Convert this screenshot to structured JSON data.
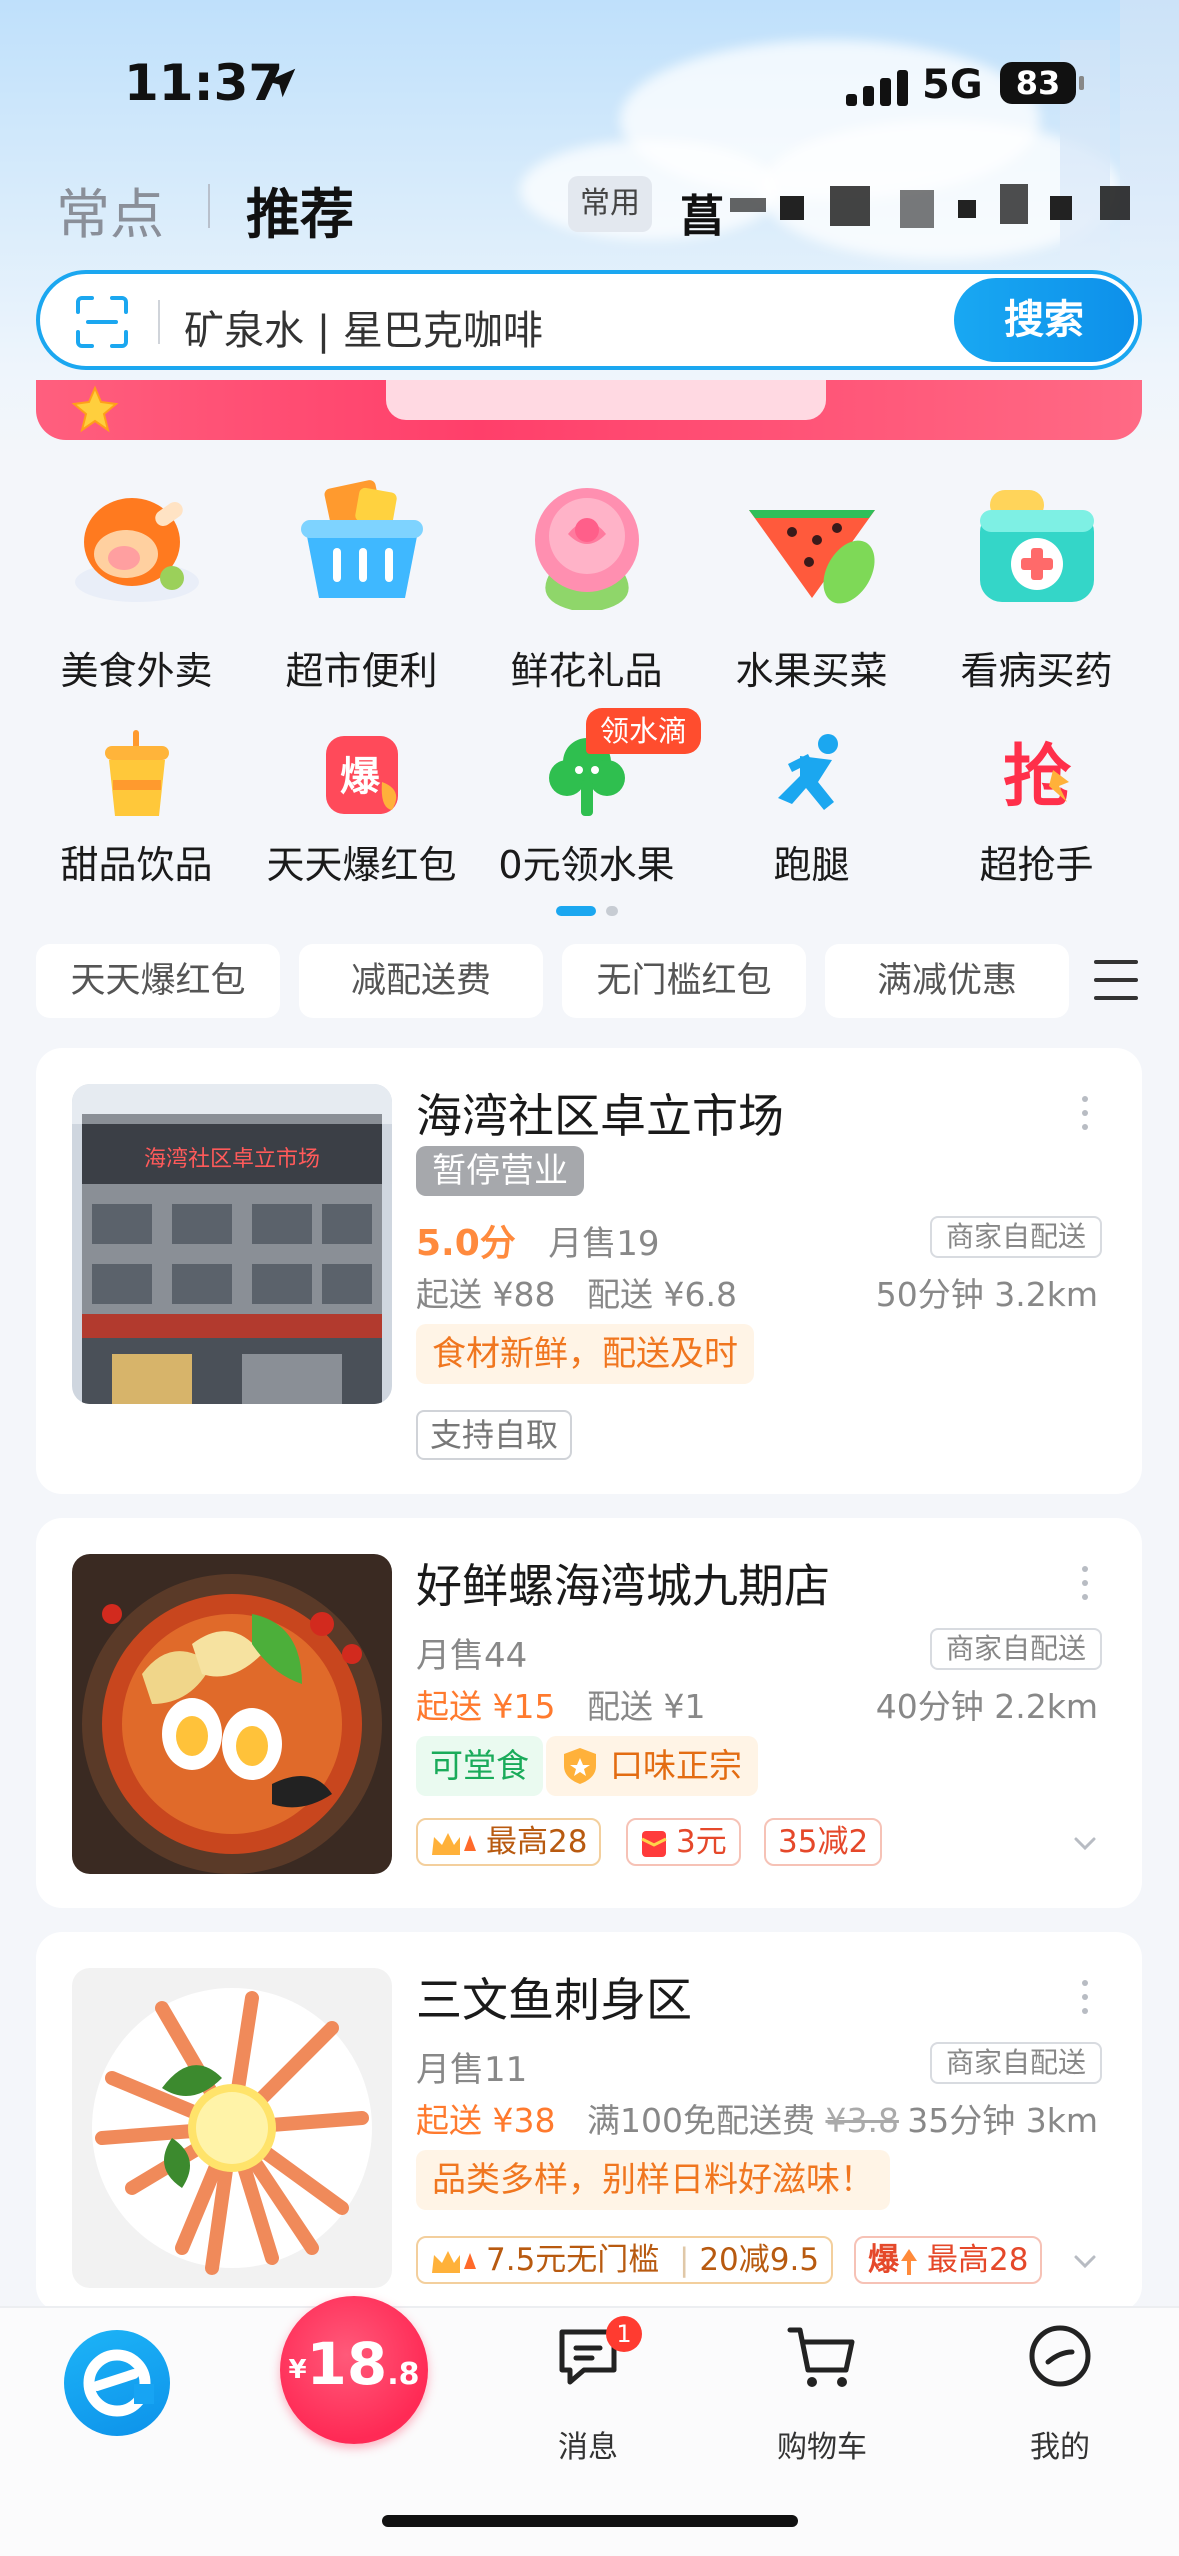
{
  "status_bar": {
    "time": "11:37",
    "network": "5G",
    "battery": "83"
  },
  "header": {
    "tabs": [
      "常点",
      "推荐"
    ],
    "address_chip": "常用",
    "address_text": "菖"
  },
  "search": {
    "placeholder": "矿泉水 | 星巴克咖啡",
    "button": "搜索"
  },
  "categories_row1": [
    {
      "label": "美食外卖",
      "icon": "food-icon"
    },
    {
      "label": "超市便利",
      "icon": "basket-icon"
    },
    {
      "label": "鲜花礼品",
      "icon": "rose-icon"
    },
    {
      "label": "水果买菜",
      "icon": "watermelon-icon"
    },
    {
      "label": "看病买药",
      "icon": "medicine-icon"
    }
  ],
  "categories_row2": [
    {
      "label": "甜品饮品",
      "icon": "drink-icon"
    },
    {
      "label": "天天爆红包",
      "icon": "red-packet-icon",
      "icon_text": "爆"
    },
    {
      "label": "0元领水果",
      "icon": "tree-icon",
      "badge": "领水滴"
    },
    {
      "label": "跑腿",
      "icon": "runner-icon"
    },
    {
      "label": "超抢手",
      "icon": "grab-icon",
      "icon_text": "抢"
    }
  ],
  "filters": [
    "天天爆红包",
    "减配送费",
    "无门槛红包",
    "满减优惠"
  ],
  "shops": [
    {
      "name": "海湾社区卓立市场",
      "status": "暂停营业",
      "rating": "5.0分",
      "monthly_sales": "月售19",
      "delivery_type": "商家自配送",
      "min_order": "起送 ¥88",
      "delivery_fee": "配送 ¥6.8",
      "eta_distance": "50分钟 3.2km",
      "feature": "食材新鲜，配送及时",
      "tag": "支持自取",
      "sign_text": "海湾社区卓立市场"
    },
    {
      "name": "好鲜螺海湾城九期店",
      "monthly_sales": "月售44",
      "delivery_type": "商家自配送",
      "min_order": "起送 ¥15",
      "delivery_fee": "配送 ¥1",
      "eta_distance": "40分钟 2.2km",
      "tag_green": "可堂食",
      "tag_gold": "口味正宗",
      "promos": [
        "最高28",
        "3元",
        "35减2"
      ]
    },
    {
      "name": "三文鱼刺身区",
      "monthly_sales": "月售11",
      "delivery_type": "商家自配送",
      "min_order": "起送 ¥38",
      "delivery_fee": "满100免配送费",
      "old_fee": "¥3.8",
      "eta_distance": "35分钟 3km",
      "feature": "品类多样，别样日料好滋味！",
      "promos": [
        "7.5元无门槛",
        "20减9.5",
        "最高28"
      ],
      "promo_prefix": "爆"
    }
  ],
  "tabbar": {
    "red_amount": {
      "currency": "¥",
      "main": "18",
      "decimal": ".8"
    },
    "items": [
      {
        "label": "消息",
        "badge": "1",
        "icon": "message-icon"
      },
      {
        "label": "购物车",
        "icon": "cart-icon"
      },
      {
        "label": "我的",
        "icon": "profile-icon"
      }
    ]
  },
  "colors": {
    "accent": "#1ba7f0",
    "orange": "#ff7a2e",
    "red": "#ff2a55"
  }
}
